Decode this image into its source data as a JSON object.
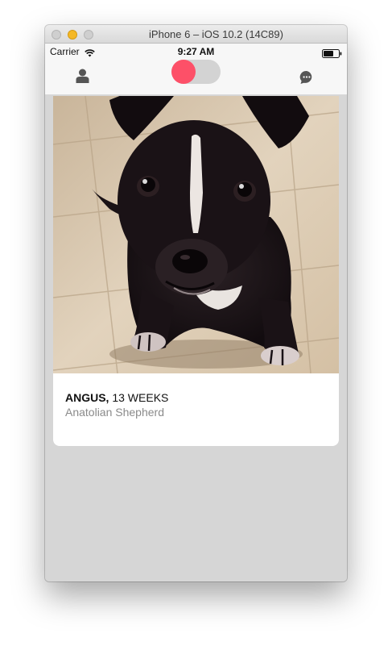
{
  "window": {
    "title": "iPhone 6 – iOS 10.2 (14C89)"
  },
  "status_bar": {
    "carrier": "Carrier",
    "time": "9:27 AM",
    "wifi_icon": "wifi-icon",
    "battery_icon": "battery-icon"
  },
  "nav_bar": {
    "left_icon": "person-icon",
    "center_toggle": {
      "state": "left",
      "accent_color": "#fd5068"
    },
    "right_icon": "chat-bubble-icon"
  },
  "card": {
    "name": "ANGUS,",
    "age": "13 WEEKS",
    "breed": "Anatolian Shepherd",
    "photo": "black puppy with white blaze sitting on tiled floor"
  },
  "colors": {
    "accent": "#fd5068",
    "background": "#d6d6d6",
    "card": "#ffffff"
  }
}
